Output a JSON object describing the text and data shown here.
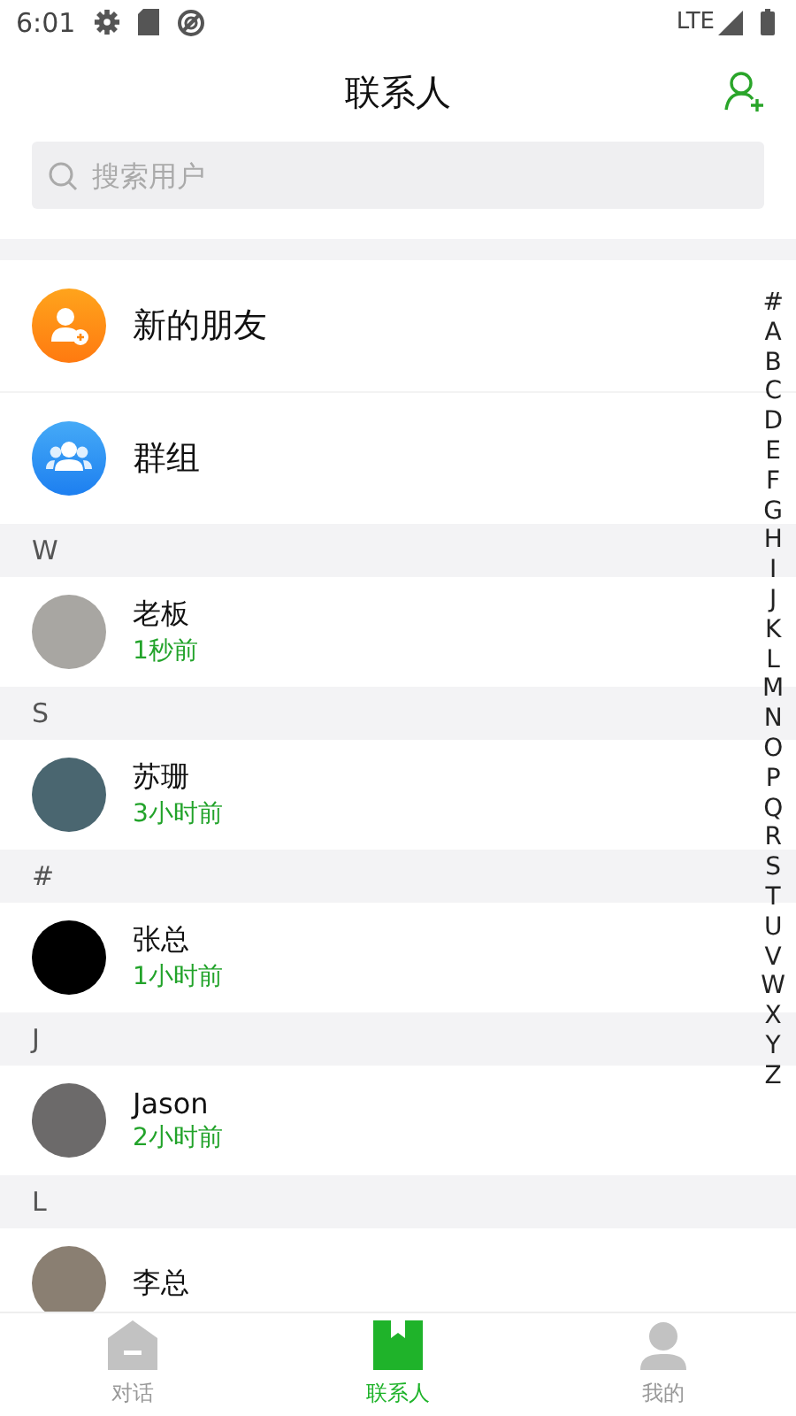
{
  "status_bar": {
    "time": "6:01",
    "network": "LTE"
  },
  "header": {
    "title": "联系人"
  },
  "search": {
    "placeholder": "搜索用户"
  },
  "shortcuts": [
    {
      "kind": "new-friends",
      "label": "新的朋友"
    },
    {
      "kind": "groups",
      "label": "群组"
    }
  ],
  "sections": [
    {
      "letter": "W",
      "contacts": [
        {
          "name": "老板",
          "last_seen": "1秒前"
        }
      ]
    },
    {
      "letter": "S",
      "contacts": [
        {
          "name": "苏珊",
          "last_seen": "3小时前"
        }
      ]
    },
    {
      "letter": "#",
      "contacts": [
        {
          "name": "张总",
          "last_seen": "1小时前"
        }
      ]
    },
    {
      "letter": "J",
      "contacts": [
        {
          "name": "Jason",
          "last_seen": "2小时前"
        }
      ]
    },
    {
      "letter": "L",
      "contacts": [
        {
          "name": "李总"
        }
      ]
    }
  ],
  "index_letters": [
    "#",
    "A",
    "B",
    "C",
    "D",
    "E",
    "F",
    "G",
    "H",
    "I",
    "J",
    "K",
    "L",
    "M",
    "N",
    "O",
    "P",
    "Q",
    "R",
    "S",
    "T",
    "U",
    "V",
    "W",
    "X",
    "Y",
    "Z"
  ],
  "tabs": [
    {
      "kind": "chat",
      "label": "对话",
      "selected": false
    },
    {
      "kind": "contacts",
      "label": "联系人",
      "selected": true
    },
    {
      "kind": "me",
      "label": "我的",
      "selected": false
    }
  ]
}
